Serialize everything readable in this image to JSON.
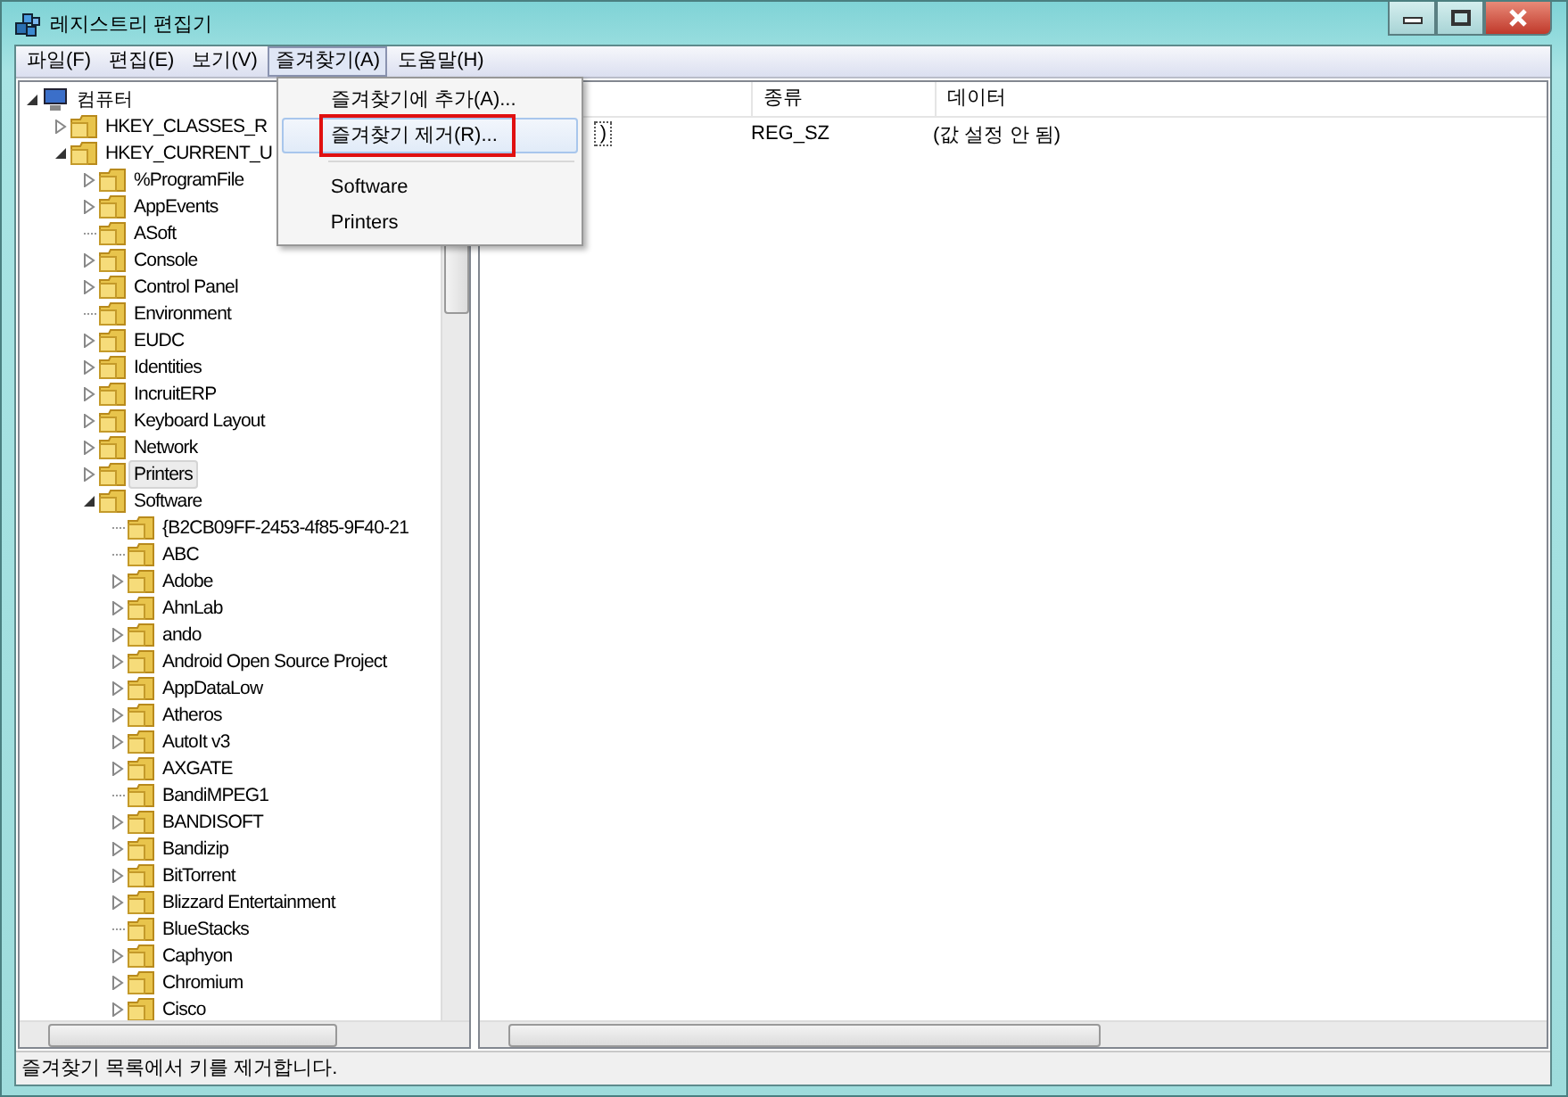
{
  "window": {
    "title": "레지스트리 편집기"
  },
  "menu_bar": [
    {
      "label": "파일(F)",
      "selected": false
    },
    {
      "label": "편집(E)",
      "selected": false
    },
    {
      "label": "보기(V)",
      "selected": false
    },
    {
      "label": "즐겨찾기(A)",
      "selected": true
    },
    {
      "label": "도움말(H)",
      "selected": false
    }
  ],
  "favorites_menu": [
    {
      "kind": "item",
      "label": "즐겨찾기에 추가(A)...",
      "selected": false,
      "annotated": false
    },
    {
      "kind": "item",
      "label": "즐겨찾기 제거(R)...",
      "selected": true,
      "annotated": true
    },
    {
      "kind": "separator"
    },
    {
      "kind": "item",
      "label": "Software",
      "selected": false,
      "annotated": false
    },
    {
      "kind": "item",
      "label": "Printers",
      "selected": false,
      "annotated": false
    }
  ],
  "tree": [
    {
      "label": "컴퓨터",
      "kind": "computer",
      "expandable": true,
      "expanded": true,
      "selected": false,
      "children": [
        {
          "label": "HKEY_CLASSES_R",
          "kind": "folder",
          "expandable": true,
          "expanded": false,
          "selected": false
        },
        {
          "label": "HKEY_CURRENT_U",
          "kind": "folder",
          "expandable": true,
          "expanded": true,
          "selected": false,
          "children": [
            {
              "label": "%ProgramFile",
              "kind": "folder",
              "expandable": true,
              "expanded": false,
              "selected": false
            },
            {
              "label": "AppEvents",
              "kind": "folder",
              "expandable": true,
              "expanded": false,
              "selected": false
            },
            {
              "label": "ASoft",
              "kind": "folder",
              "expandable": false,
              "selected": false
            },
            {
              "label": "Console",
              "kind": "folder",
              "expandable": true,
              "expanded": false,
              "selected": false
            },
            {
              "label": "Control Panel",
              "kind": "folder",
              "expandable": true,
              "expanded": false,
              "selected": false
            },
            {
              "label": "Environment",
              "kind": "folder",
              "expandable": false,
              "selected": false
            },
            {
              "label": "EUDC",
              "kind": "folder",
              "expandable": true,
              "expanded": false,
              "selected": false
            },
            {
              "label": "Identities",
              "kind": "folder",
              "expandable": true,
              "expanded": false,
              "selected": false
            },
            {
              "label": "IncruitERP",
              "kind": "folder",
              "expandable": true,
              "expanded": false,
              "selected": false
            },
            {
              "label": "Keyboard Layout",
              "kind": "folder",
              "expandable": true,
              "expanded": false,
              "selected": false
            },
            {
              "label": "Network",
              "kind": "folder",
              "expandable": true,
              "expanded": false,
              "selected": false
            },
            {
              "label": "Printers",
              "kind": "folder",
              "expandable": true,
              "expanded": false,
              "selected": true
            },
            {
              "label": "Software",
              "kind": "folder",
              "expandable": true,
              "expanded": true,
              "selected": false,
              "children": [
                {
                  "label": "{B2CB09FF-2453-4f85-9F40-21",
                  "kind": "folder",
                  "expandable": false,
                  "selected": false
                },
                {
                  "label": "ABC",
                  "kind": "folder",
                  "expandable": false,
                  "selected": false
                },
                {
                  "label": "Adobe",
                  "kind": "folder",
                  "expandable": true,
                  "expanded": false,
                  "selected": false
                },
                {
                  "label": "AhnLab",
                  "kind": "folder",
                  "expandable": true,
                  "expanded": false,
                  "selected": false
                },
                {
                  "label": "ando",
                  "kind": "folder",
                  "expandable": true,
                  "expanded": false,
                  "selected": false
                },
                {
                  "label": "Android Open Source Project",
                  "kind": "folder",
                  "expandable": true,
                  "expanded": false,
                  "selected": false
                },
                {
                  "label": "AppDataLow",
                  "kind": "folder",
                  "expandable": true,
                  "expanded": false,
                  "selected": false
                },
                {
                  "label": "Atheros",
                  "kind": "folder",
                  "expandable": true,
                  "expanded": false,
                  "selected": false
                },
                {
                  "label": "AutoIt v3",
                  "kind": "folder",
                  "expandable": true,
                  "expanded": false,
                  "selected": false
                },
                {
                  "label": "AXGATE",
                  "kind": "folder",
                  "expandable": true,
                  "expanded": false,
                  "selected": false
                },
                {
                  "label": "BandiMPEG1",
                  "kind": "folder",
                  "expandable": false,
                  "selected": false
                },
                {
                  "label": "BANDISOFT",
                  "kind": "folder",
                  "expandable": true,
                  "expanded": false,
                  "selected": false
                },
                {
                  "label": "Bandizip",
                  "kind": "folder",
                  "expandable": true,
                  "expanded": false,
                  "selected": false
                },
                {
                  "label": "BitTorrent",
                  "kind": "folder",
                  "expandable": true,
                  "expanded": false,
                  "selected": false
                },
                {
                  "label": "Blizzard Entertainment",
                  "kind": "folder",
                  "expandable": true,
                  "expanded": false,
                  "selected": false
                },
                {
                  "label": "BlueStacks",
                  "kind": "folder",
                  "expandable": false,
                  "selected": false
                },
                {
                  "label": "Caphyon",
                  "kind": "folder",
                  "expandable": true,
                  "expanded": false,
                  "selected": false
                },
                {
                  "label": "Chromium",
                  "kind": "folder",
                  "expandable": true,
                  "expanded": false,
                  "selected": false
                },
                {
                  "label": "Cisco",
                  "kind": "folder",
                  "expandable": true,
                  "expanded": false,
                  "selected": false
                }
              ]
            }
          ]
        }
      ]
    }
  ],
  "values_table": {
    "columns": [
      "종류",
      "데이터"
    ],
    "rows": [
      {
        "name": ")",
        "type": "REG_SZ",
        "data": "(값 설정 안 됨)",
        "focused": true
      }
    ]
  },
  "status_bar": "즐겨찾기 목록에서 키를 제거합니다."
}
